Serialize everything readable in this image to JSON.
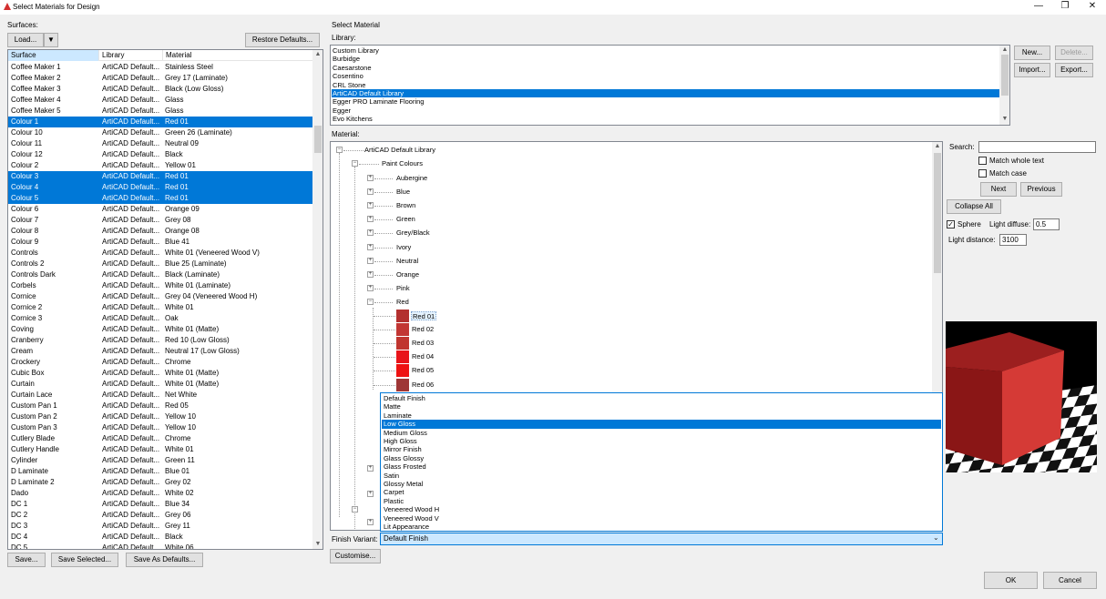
{
  "window": {
    "title": "Select Materials for Design",
    "minimize": "—",
    "restore": "❐",
    "close": "✕"
  },
  "left": {
    "group_label": "Surfaces:",
    "load_button": "Load...",
    "load_dropdown": "▼",
    "restore_defaults": "Restore Defaults...",
    "columns": [
      "Surface",
      "Library",
      "Material"
    ],
    "rows": [
      {
        "surface": "Coffee Maker 1",
        "library": "ArtiCAD Default...",
        "material": "Stainless Steel",
        "selected": false
      },
      {
        "surface": "Coffee Maker 2",
        "library": "ArtiCAD Default...",
        "material": "Grey 17 (Laminate)",
        "selected": false
      },
      {
        "surface": "Coffee Maker 3",
        "library": "ArtiCAD Default...",
        "material": "Black (Low Gloss)",
        "selected": false
      },
      {
        "surface": "Coffee Maker 4",
        "library": "ArtiCAD Default...",
        "material": "Glass",
        "selected": false
      },
      {
        "surface": "Coffee Maker 5",
        "library": "ArtiCAD Default...",
        "material": "Glass",
        "selected": false
      },
      {
        "surface": "Colour 1",
        "library": "ArtiCAD Default...",
        "material": "Red 01",
        "selected": true
      },
      {
        "surface": "Colour 10",
        "library": "ArtiCAD Default...",
        "material": "Green 26 (Laminate)",
        "selected": false
      },
      {
        "surface": "Colour 11",
        "library": "ArtiCAD Default...",
        "material": "Neutral 09",
        "selected": false
      },
      {
        "surface": "Colour 12",
        "library": "ArtiCAD Default...",
        "material": "Black",
        "selected": false
      },
      {
        "surface": "Colour 2",
        "library": "ArtiCAD Default...",
        "material": "Yellow 01",
        "selected": false
      },
      {
        "surface": "Colour 3",
        "library": "ArtiCAD Default...",
        "material": "Red 01",
        "selected": true
      },
      {
        "surface": "Colour 4",
        "library": "ArtiCAD Default...",
        "material": "Red 01",
        "selected": true
      },
      {
        "surface": "Colour 5",
        "library": "ArtiCAD Default...",
        "material": "Red 01",
        "selected": true
      },
      {
        "surface": "Colour 6",
        "library": "ArtiCAD Default...",
        "material": "Orange 09",
        "selected": false
      },
      {
        "surface": "Colour 7",
        "library": "ArtiCAD Default...",
        "material": "Grey 08",
        "selected": false
      },
      {
        "surface": "Colour 8",
        "library": "ArtiCAD Default...",
        "material": "Orange 08",
        "selected": false
      },
      {
        "surface": "Colour 9",
        "library": "ArtiCAD Default...",
        "material": "Blue 41",
        "selected": false
      },
      {
        "surface": "Controls",
        "library": "ArtiCAD Default...",
        "material": "White 01 (Veneered Wood V)",
        "selected": false
      },
      {
        "surface": "Controls 2",
        "library": "ArtiCAD Default...",
        "material": "Blue 25 (Laminate)",
        "selected": false
      },
      {
        "surface": "Controls Dark",
        "library": "ArtiCAD Default...",
        "material": "Black (Laminate)",
        "selected": false
      },
      {
        "surface": "Corbels",
        "library": "ArtiCAD Default...",
        "material": "White 01 (Laminate)",
        "selected": false
      },
      {
        "surface": "Cornice",
        "library": "ArtiCAD Default...",
        "material": "Grey 04 (Veneered Wood H)",
        "selected": false
      },
      {
        "surface": "Cornice 2",
        "library": "ArtiCAD Default...",
        "material": "White 01",
        "selected": false
      },
      {
        "surface": "Cornice 3",
        "library": "ArtiCAD Default...",
        "material": "Oak",
        "selected": false
      },
      {
        "surface": "Coving",
        "library": "ArtiCAD Default...",
        "material": "White 01 (Matte)",
        "selected": false
      },
      {
        "surface": "Cranberry",
        "library": "ArtiCAD Default...",
        "material": "Red 10 (Low Gloss)",
        "selected": false
      },
      {
        "surface": "Cream",
        "library": "ArtiCAD Default...",
        "material": "Neutral 17 (Low Gloss)",
        "selected": false
      },
      {
        "surface": "Crockery",
        "library": "ArtiCAD Default...",
        "material": "Chrome",
        "selected": false
      },
      {
        "surface": "Cubic Box",
        "library": "ArtiCAD Default...",
        "material": "White 01 (Matte)",
        "selected": false
      },
      {
        "surface": "Curtain",
        "library": "ArtiCAD Default...",
        "material": "White 01 (Matte)",
        "selected": false
      },
      {
        "surface": "Curtain Lace",
        "library": "ArtiCAD Default...",
        "material": "Net White",
        "selected": false
      },
      {
        "surface": "Custom Pan 1",
        "library": "ArtiCAD Default...",
        "material": "Red 05",
        "selected": false
      },
      {
        "surface": "Custom Pan 2",
        "library": "ArtiCAD Default...",
        "material": "Yellow 10",
        "selected": false
      },
      {
        "surface": "Custom Pan 3",
        "library": "ArtiCAD Default...",
        "material": "Yellow 10",
        "selected": false
      },
      {
        "surface": "Cutlery Blade",
        "library": "ArtiCAD Default...",
        "material": "Chrome",
        "selected": false
      },
      {
        "surface": "Cutlery Handle",
        "library": "ArtiCAD Default...",
        "material": "White 01",
        "selected": false
      },
      {
        "surface": "Cylinder",
        "library": "ArtiCAD Default...",
        "material": "Green 11",
        "selected": false
      },
      {
        "surface": "D Laminate",
        "library": "ArtiCAD Default...",
        "material": "Blue 01",
        "selected": false
      },
      {
        "surface": "D Laminate 2",
        "library": "ArtiCAD Default...",
        "material": "Grey 02",
        "selected": false
      },
      {
        "surface": "Dado",
        "library": "ArtiCAD Default...",
        "material": "White 02",
        "selected": false
      },
      {
        "surface": "DC 1",
        "library": "ArtiCAD Default...",
        "material": "Blue 34",
        "selected": false
      },
      {
        "surface": "DC 2",
        "library": "ArtiCAD Default...",
        "material": "Grey 06",
        "selected": false
      },
      {
        "surface": "DC 3",
        "library": "ArtiCAD Default...",
        "material": "Grey 11",
        "selected": false
      },
      {
        "surface": "DC 4",
        "library": "ArtiCAD Default...",
        "material": "Black",
        "selected": false
      },
      {
        "surface": "DC 5",
        "library": "ArtiCAD Default...",
        "material": "White 06",
        "selected": false
      }
    ],
    "save": "Save...",
    "save_selected": "Save Selected...",
    "save_as_defaults": "Save As Defaults..."
  },
  "right": {
    "group_label": "Select Material",
    "library_label": "Library:",
    "libraries": [
      {
        "name": "Custom Library",
        "selected": false
      },
      {
        "name": "Burbidge",
        "selected": false
      },
      {
        "name": "Caesarstone",
        "selected": false
      },
      {
        "name": "Cosentino",
        "selected": false
      },
      {
        "name": "CRL Stone",
        "selected": false
      },
      {
        "name": "ArtiCAD Default Library",
        "selected": true
      },
      {
        "name": "Egger PRO Laminate Flooring",
        "selected": false
      },
      {
        "name": "Egger",
        "selected": false
      },
      {
        "name": "Evo Kitchens",
        "selected": false
      }
    ],
    "new_button": "New...",
    "delete_button": "Delete...",
    "import_button": "Import...",
    "export_button": "Export...",
    "material_label": "Material:",
    "tree": {
      "root": "ArtiCAD Default Library",
      "group": "Paint Colours",
      "categories": [
        "Aubergine",
        "Blue",
        "Brown",
        "Green",
        "Grey/Black",
        "Ivory",
        "Neutral",
        "Orange",
        "Pink",
        "Red"
      ],
      "reds": [
        {
          "name": "Red 01",
          "color": "#b3302f"
        },
        {
          "name": "Red 02",
          "color": "#c23633"
        },
        {
          "name": "Red 03",
          "color": "#c0352f"
        },
        {
          "name": "Red 04",
          "color": "#e8141a"
        },
        {
          "name": "Red 05",
          "color": "#ee1212"
        },
        {
          "name": "Red 06",
          "color": "#9e3636"
        }
      ]
    },
    "finish_options": [
      {
        "label": "Default Finish",
        "selected": false
      },
      {
        "label": "Matte",
        "selected": false
      },
      {
        "label": "Laminate",
        "selected": false
      },
      {
        "label": "Low Gloss",
        "selected": true
      },
      {
        "label": "Medium Gloss",
        "selected": false
      },
      {
        "label": "High Gloss",
        "selected": false
      },
      {
        "label": "Mirror Finish",
        "selected": false
      },
      {
        "label": "Glass Glossy",
        "selected": false
      },
      {
        "label": "Glass Frosted",
        "selected": false
      },
      {
        "label": "Satin",
        "selected": false
      },
      {
        "label": "Glossy Metal",
        "selected": false
      },
      {
        "label": "Carpet",
        "selected": false
      },
      {
        "label": "Plastic",
        "selected": false
      },
      {
        "label": "Veneered Wood H",
        "selected": false
      },
      {
        "label": "Veneered Wood V",
        "selected": false
      },
      {
        "label": "Lit Appearance",
        "selected": false
      }
    ],
    "finish_variant_label": "Finish Variant:",
    "finish_variant_value": "Default Finish",
    "customise": "Customise...",
    "search_label": "Search:",
    "search_value": "",
    "match_whole_text": "Match whole text",
    "match_case": "Match case",
    "next": "Next",
    "previous": "Previous",
    "collapse_all": "Collapse All",
    "sphere_label": "Sphere",
    "sphere_checked": true,
    "light_diffuse_label": "Light diffuse:",
    "light_diffuse_value": "0.5",
    "light_distance_label": "Light distance:",
    "light_distance_value": "3100",
    "preview_color": "#c83232"
  },
  "footer": {
    "ok": "OK",
    "cancel": "Cancel"
  }
}
